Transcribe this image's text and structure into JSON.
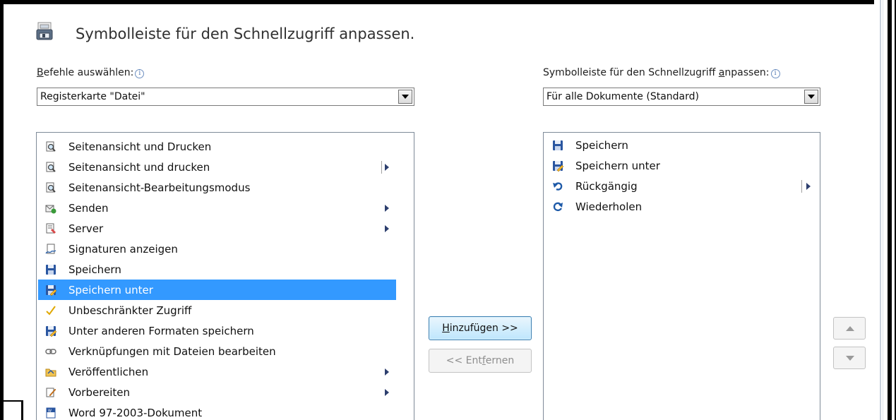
{
  "header": {
    "title": "Symbolleiste für den Schnellzugriff anpassen."
  },
  "left": {
    "label_prefix": "",
    "label_access": "B",
    "label_rest": "efehle auswählen:",
    "combo_value": "Registerkarte \"Datei\"",
    "items": [
      {
        "label": "Seitenansicht und Drucken",
        "icon": "print-preview-icon",
        "submenu": false,
        "selected": false
      },
      {
        "label": "Seitenansicht und drucken",
        "icon": "print-preview-icon",
        "submenu": true,
        "selected": false
      },
      {
        "label": "Seitenansicht-Bearbeitungsmodus",
        "icon": "print-preview-icon",
        "submenu": false,
        "selected": false
      },
      {
        "label": "Senden",
        "icon": "send-icon",
        "submenu": true,
        "selected": false
      },
      {
        "label": "Server",
        "icon": "server-icon",
        "submenu": true,
        "selected": false
      },
      {
        "label": "Signaturen anzeigen",
        "icon": "signature-icon",
        "submenu": false,
        "selected": false
      },
      {
        "label": "Speichern",
        "icon": "save-icon",
        "submenu": false,
        "selected": false
      },
      {
        "label": "Speichern unter",
        "icon": "save-as-icon",
        "submenu": false,
        "selected": true
      },
      {
        "label": "Unbeschränkter Zugriff",
        "icon": "checkmark-icon",
        "submenu": false,
        "selected": false
      },
      {
        "label": "Unter anderen Formaten speichern",
        "icon": "save-as-icon",
        "submenu": false,
        "selected": false
      },
      {
        "label": "Verknüpfungen mit Dateien bearbeiten",
        "icon": "link-icon",
        "submenu": false,
        "selected": false
      },
      {
        "label": "Veröffentlichen",
        "icon": "publish-folder-icon",
        "submenu": true,
        "selected": false
      },
      {
        "label": "Vorbereiten",
        "icon": "prepare-icon",
        "submenu": true,
        "selected": false
      },
      {
        "label": "Word 97-2003-Dokument",
        "icon": "word-document-icon",
        "submenu": false,
        "selected": false
      }
    ]
  },
  "right": {
    "label_prefix": "Symbolleiste für den Schnellzugriff ",
    "label_access": "a",
    "label_rest": "npassen:",
    "combo_value": "Für alle Dokumente (Standard)",
    "items": [
      {
        "label": "Speichern",
        "icon": "save-icon"
      },
      {
        "label": "Speichern unter",
        "icon": "save-as-icon"
      },
      {
        "label": "Rückgängig",
        "icon": "undo-icon"
      },
      {
        "label": "Wiederholen",
        "icon": "redo-icon"
      }
    ]
  },
  "buttons": {
    "add_access": "H",
    "add_rest": "inzufügen >>",
    "remove_pre": "<< Ent",
    "remove_access": "f",
    "remove_rest": "ernen"
  },
  "colors": {
    "selection": "#3399ff",
    "accent_arrow": "#2d3f6e"
  }
}
